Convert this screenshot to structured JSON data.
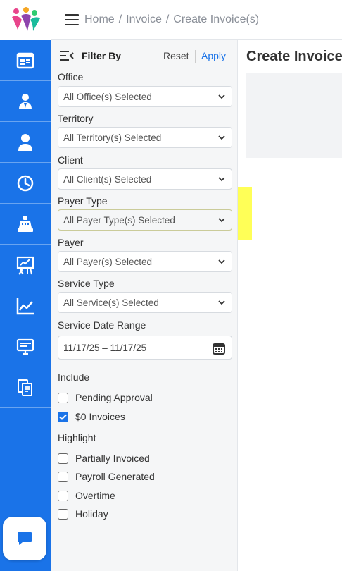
{
  "breadcrumb": {
    "home": "Home",
    "invoice": "Invoice",
    "current": "Create Invoice(s)",
    "separator": "/"
  },
  "sidebar": {
    "icons": [
      "dashboard-icon",
      "user-group-icon",
      "user-icon",
      "clock-icon",
      "cash-register-icon",
      "presentation-icon",
      "chart-icon",
      "monitor-icon",
      "documents-icon"
    ],
    "chat_icon": "chat-icon",
    "accent": "#1a73e8"
  },
  "filter": {
    "title": "Filter By",
    "reset": "Reset",
    "apply": "Apply",
    "office_label": "Office",
    "office_value": "All Office(s) Selected",
    "territory_label": "Territory",
    "territory_value": "All Territory(s) Selected",
    "client_label": "Client",
    "client_value": "All Client(s) Selected",
    "payer_type_label": "Payer Type",
    "payer_type_value": "All Payer Type(s) Selected",
    "payer_label": "Payer",
    "payer_value": "All Payer(s) Selected",
    "service_type_label": "Service Type",
    "service_type_value": "All Service(s) Selected",
    "date_range_label": "Service Date Range",
    "date_range_value": "11/17/25 – 11/17/25",
    "include_label": "Include",
    "include": [
      {
        "label": "Pending Approval",
        "checked": false
      },
      {
        "label": "$0 Invoices",
        "checked": true
      }
    ],
    "highlight_label": "Highlight",
    "highlight": [
      {
        "label": "Partially Invoiced",
        "checked": false
      },
      {
        "label": "Payroll Generated",
        "checked": false
      },
      {
        "label": "Overtime",
        "checked": false
      },
      {
        "label": "Holiday",
        "checked": false
      }
    ],
    "highlight_color": "#ffff3a"
  },
  "main": {
    "title": "Create Invoice"
  }
}
